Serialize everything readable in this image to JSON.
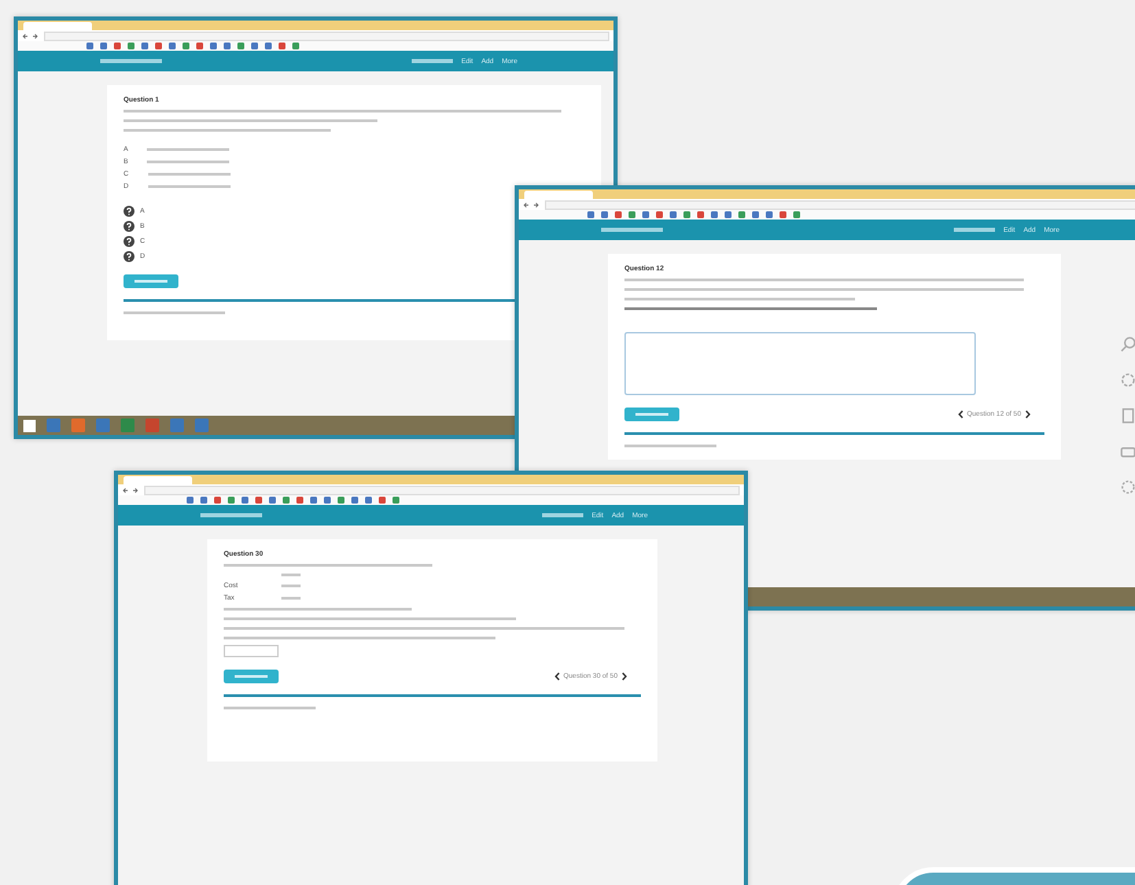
{
  "windows": [
    {
      "kind": "choice",
      "nav_links": [
        "Edit",
        "Add",
        "More"
      ],
      "question": "Question 1",
      "options": [
        "A",
        "B",
        "C",
        "D"
      ],
      "answers": [
        "A",
        "B",
        "C",
        "D"
      ]
    },
    {
      "kind": "text",
      "nav_links": [
        "Edit",
        "Add",
        "More"
      ],
      "question": "Question 12",
      "pager": "Question 12 of 50"
    },
    {
      "kind": "table",
      "nav_links": [
        "Edit",
        "Add",
        "More"
      ],
      "question": "Question 30",
      "rows": [
        "Cost",
        "Tax"
      ],
      "pager": "Question 30 of 50"
    }
  ]
}
